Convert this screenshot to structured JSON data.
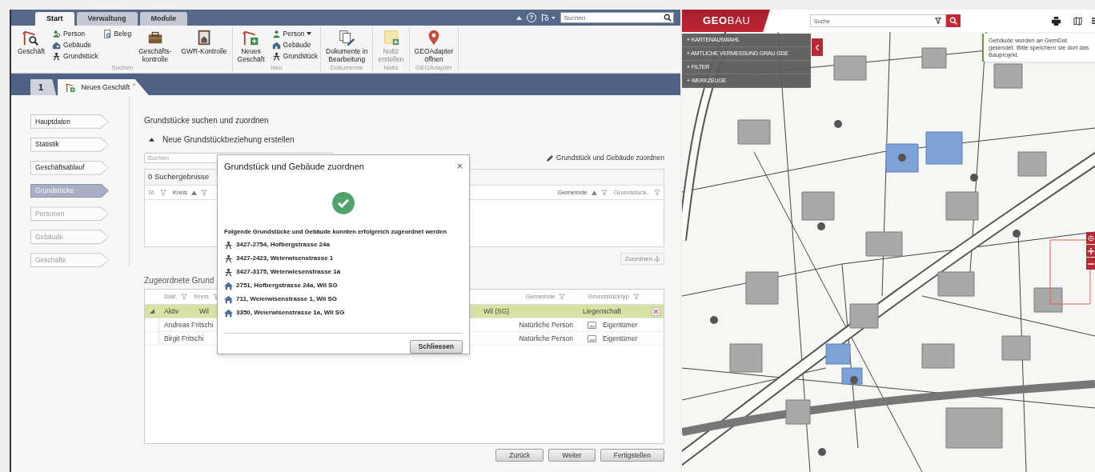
{
  "ribbon": {
    "tabs": [
      {
        "label": "Start",
        "selected": true
      },
      {
        "label": "Verwaltung",
        "selected": false
      },
      {
        "label": "Module",
        "selected": false
      }
    ],
    "help": "?",
    "search": {
      "placeholder": "Suchen"
    },
    "groups": [
      {
        "label": "Suchen",
        "items": [
          {
            "kind": "large",
            "label": "Geschäft",
            "disabled": false
          },
          {
            "kind": "small",
            "label": "Person",
            "disabled": false
          },
          {
            "kind": "small",
            "label": "Gebäude",
            "disabled": false
          },
          {
            "kind": "small",
            "label": "Grundstück",
            "disabled": false
          },
          {
            "kind": "small",
            "label": "Beleg",
            "disabled": false
          },
          {
            "kind": "large",
            "label": "Geschäfts-\nkontrolle",
            "disabled": false
          },
          {
            "kind": "large",
            "label": "GWR-Kontrolle",
            "disabled": false
          }
        ]
      },
      {
        "label": "Neu",
        "items": [
          {
            "kind": "large",
            "label": "Neues\nGeschäft",
            "disabled": false
          },
          {
            "kind": "small",
            "label": "Person",
            "disabled": false,
            "dropdown": true
          },
          {
            "kind": "small",
            "label": "Gebäude",
            "disabled": false
          },
          {
            "kind": "small",
            "label": "Grundstück",
            "disabled": false
          }
        ]
      },
      {
        "label": "Dokumente",
        "items": [
          {
            "kind": "large",
            "label": "Dokumente in\nBearbeitung",
            "disabled": false
          }
        ]
      },
      {
        "label": "Notiz",
        "items": [
          {
            "kind": "large",
            "label": "Notiz\nerstellen",
            "disabled": true
          }
        ]
      },
      {
        "label": "GEOAdapter",
        "items": [
          {
            "kind": "large",
            "label": "GEOAdapter\nöffnen",
            "disabled": false
          }
        ]
      }
    ]
  },
  "document_tabs": [
    {
      "label": "1",
      "selected": false
    },
    {
      "label": "Neues Geschäft",
      "selected": true,
      "close": "×"
    }
  ],
  "steps": [
    {
      "label": "Hauptdaten",
      "selected": false,
      "disabled": false
    },
    {
      "label": "Statistik",
      "selected": false,
      "disabled": false
    },
    {
      "label": "Geschäftsablauf",
      "selected": false,
      "disabled": false
    },
    {
      "label": "Grundstücke",
      "selected": true,
      "disabled": false
    },
    {
      "label": "Personen",
      "selected": false,
      "disabled": true
    },
    {
      "label": "Gebäude",
      "selected": false,
      "disabled": true
    },
    {
      "label": "Geschäfte",
      "selected": false,
      "disabled": true
    }
  ],
  "panel": {
    "title": "Grundstücke suchen und zuordnen",
    "section": {
      "title": "Neue Grundstückbeziehung erstellen",
      "expanded": true
    },
    "search": {
      "placeholder": "Suchen"
    },
    "assign_link": "Grundstück und Gebäude zuordnen",
    "results": {
      "title": "0 Suchergebnisse",
      "columns": [
        {
          "label": "St.",
          "sorted": false
        },
        {
          "label": "Kreis",
          "sorted": true
        },
        {
          "label": "Gemeinde",
          "sorted": true
        },
        {
          "label": "Grundstück..",
          "sorted": false
        }
      ]
    },
    "assign_button": {
      "label": "Zuordnen",
      "disabled": true
    },
    "assigned": {
      "title": "Zugeordnete Grund",
      "columns": [
        {
          "label": "Stat."
        },
        {
          "label": "Kreis"
        },
        {
          "label": "Gemeinde"
        },
        {
          "label": "Grundstücktyp"
        }
      ],
      "rows": [
        {
          "expanded": true,
          "selected": true,
          "status": "Aktiv",
          "kreis": "Wil",
          "gemeinde": "Wil (SG)",
          "type": "Liegenschaft",
          "children": [
            {
              "name": "Andreas Fritschi",
              "person_type": "Natürliche Person",
              "role": "Eigentümer"
            },
            {
              "name": "Birgit Fritschi",
              "person_type": "Natürliche Person",
              "role": "Eigentümer"
            }
          ]
        }
      ]
    },
    "buttons": [
      "Zurück",
      "Weiter",
      "Fertigstellen"
    ]
  },
  "dialog": {
    "title": "Grundstück und Gebäude zuordnen",
    "close": "×",
    "message": "Folgende Grundstücke und Gebäude konnten erfolgreich zugeordnet werden",
    "items": [
      {
        "kind": "parcel",
        "text": "3427-2754, Hofbergstrasse 24a"
      },
      {
        "kind": "parcel",
        "text": "3427-2423, Weierwisenstrasse 1"
      },
      {
        "kind": "parcel",
        "text": "3427-3175, Weierwiesenstrasse 1a"
      },
      {
        "kind": "building",
        "text": "2751, Hofbergstrasse 24a, Wil SG"
      },
      {
        "kind": "building",
        "text": "711, Weierwisenstrasse 1, Wil SG"
      },
      {
        "kind": "building",
        "text": "3350, Weierwisenstrasse 1a, Wil SG"
      }
    ],
    "button": "Schliessen"
  },
  "map": {
    "brand": "**GEO**BAU",
    "search": {
      "placeholder": "Suche"
    },
    "menu": [
      "+ KARTENAUSWAHL",
      "+ AMTLICHE VERMESSUNG GRAU GDE",
      "+ FILTER",
      "+ WERKZEUGE"
    ],
    "notification": "Gebäude wurden an GemDat gesendet. Bitte speichern sie dort das Bauprojekt."
  }
}
